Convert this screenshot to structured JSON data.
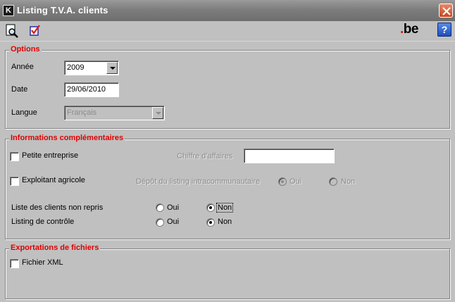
{
  "window": {
    "title": "Listing T.V.A. clients",
    "app_icon_letter": "K"
  },
  "toolbar": {
    "preview_icon": "magnifier-page-icon",
    "validate_icon": "checklist-icon",
    "logo_text": "be",
    "help_label": "?"
  },
  "options": {
    "legend": "Options",
    "year_label": "Année",
    "year_value": "2009",
    "date_label": "Date",
    "date_value": "29/06/2010",
    "language_label": "Langue",
    "language_value": "Français"
  },
  "info": {
    "legend": "Informations complémentaires",
    "small_business_label": "Petite entreprise",
    "turnover_label": "Chiffre d'affaires",
    "turnover_value": "",
    "farmer_label": "Exploitant agricole",
    "intracom_label": "Dépôt du listing intracommunautaire",
    "intracom_yes": "Oui",
    "intracom_no": "Non",
    "intracom_selected": "Oui",
    "not_included_label": "Liste des clients non repris",
    "not_included_yes": "Oui",
    "not_included_no": "Non",
    "not_included_selected": "Non",
    "control_label": "Listing de contrôle",
    "control_yes": "Oui",
    "control_no": "Non",
    "control_selected": "Non"
  },
  "export": {
    "legend": "Exportations de fichiers",
    "xml_label": "Fichier XML"
  },
  "colors": {
    "legend_red": "#e00000",
    "window_bg": "#c0c0c0"
  }
}
